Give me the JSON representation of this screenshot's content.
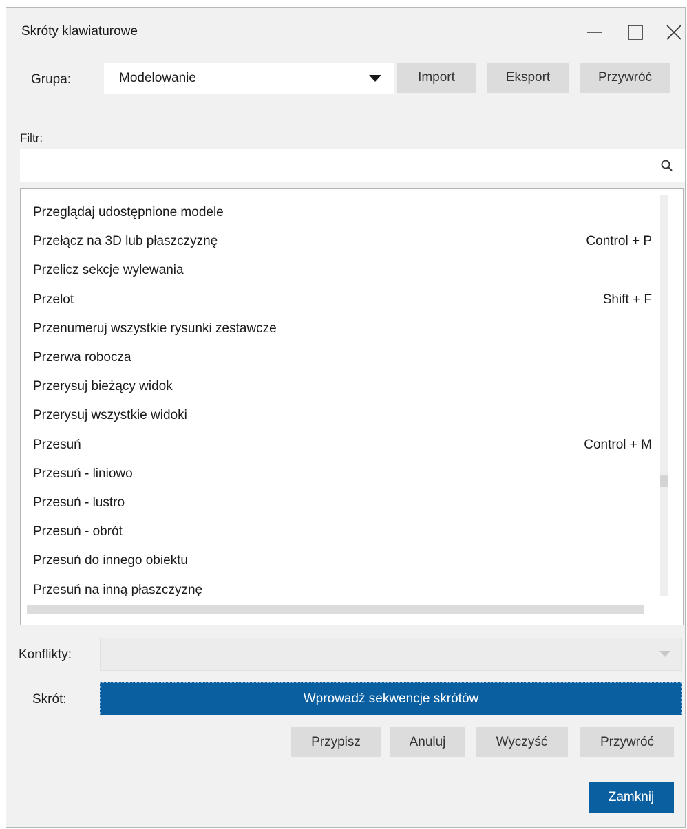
{
  "window": {
    "title": "Skróty klawiaturowe"
  },
  "group": {
    "label": "Grupa:",
    "selected": "Modelowanie"
  },
  "top_buttons": {
    "import": "Import",
    "export": "Eksport",
    "restore": "Przywróć"
  },
  "filter": {
    "label": "Filtr:",
    "value": ""
  },
  "commands": [
    {
      "name": "Przeglądaj udostępnione modele",
      "shortcut": ""
    },
    {
      "name": "Przełącz na 3D lub płaszczyznę",
      "shortcut": "Control + P"
    },
    {
      "name": "Przelicz sekcje wylewania",
      "shortcut": ""
    },
    {
      "name": "Przelot",
      "shortcut": "Shift + F"
    },
    {
      "name": "Przenumeruj wszystkie rysunki zestawcze",
      "shortcut": ""
    },
    {
      "name": "Przerwa robocza",
      "shortcut": ""
    },
    {
      "name": "Przerysuj bieżący widok",
      "shortcut": ""
    },
    {
      "name": "Przerysuj wszystkie widoki",
      "shortcut": ""
    },
    {
      "name": "Przesuń",
      "shortcut": "Control + M"
    },
    {
      "name": "Przesuń - liniowo",
      "shortcut": ""
    },
    {
      "name": "Przesuń - lustro",
      "shortcut": ""
    },
    {
      "name": "Przesuń - obrót",
      "shortcut": ""
    },
    {
      "name": "Przesuń do innego obiektu",
      "shortcut": ""
    },
    {
      "name": "Przesuń na inną płaszczyznę",
      "shortcut": ""
    }
  ],
  "conflicts": {
    "label": "Konflikty:",
    "value": ""
  },
  "shortcut": {
    "label": "Skrót:",
    "prompt": "Wprowadź sekwencje skrótów"
  },
  "bottom_buttons": {
    "assign": "Przypisz",
    "cancel": "Anuluj",
    "clear": "Wyczyść",
    "restore": "Przywróć"
  },
  "close_button": "Zamknij",
  "colors": {
    "accent": "#0a5fa0",
    "background": "#f1f1f1",
    "button": "#dcdcdc"
  },
  "icons": {
    "minimize": "minimize-icon",
    "maximize": "maximize-icon",
    "close": "close-icon",
    "dropdown": "triangle-down-icon",
    "search": "magnifier-icon"
  }
}
